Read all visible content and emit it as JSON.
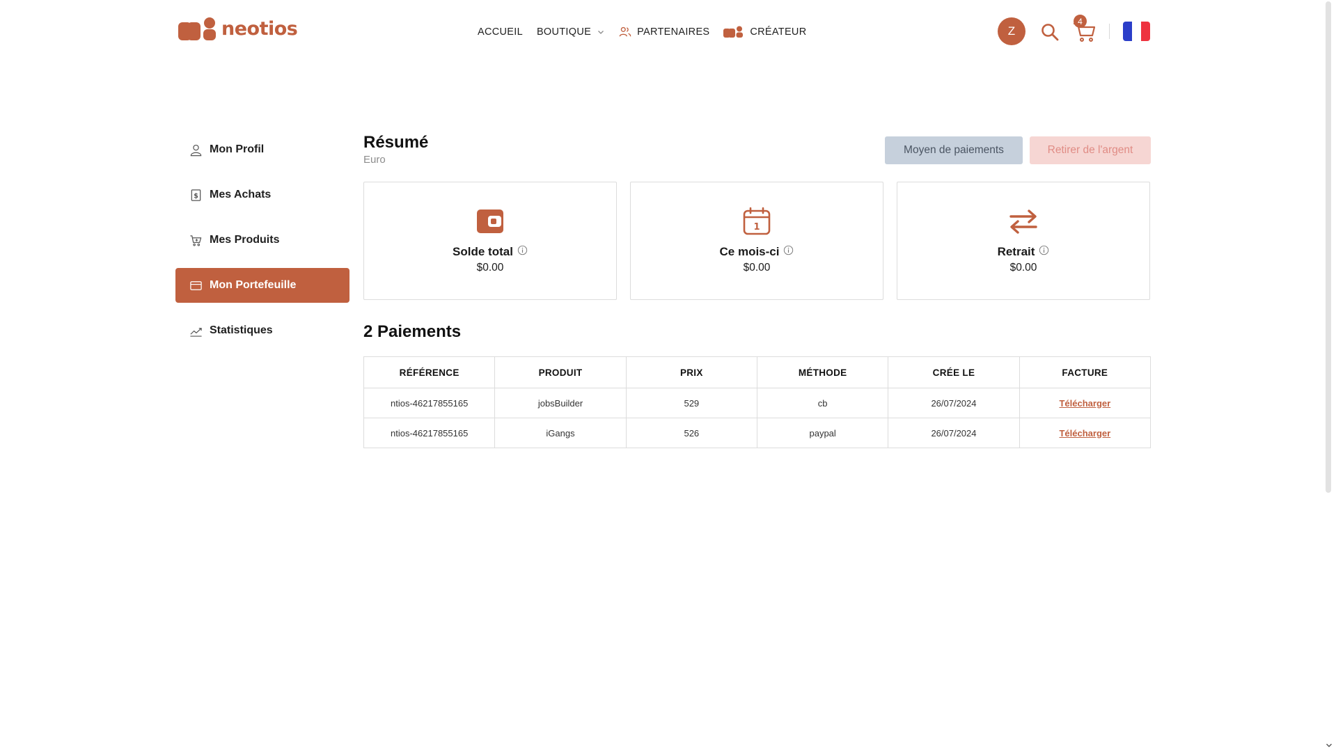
{
  "brand": {
    "name": "neotios",
    "color": "#c0603f"
  },
  "nav": {
    "items": [
      {
        "label": "ACCUEIL"
      },
      {
        "label": "BOUTIQUE",
        "icon": "chevron-down-icon"
      },
      {
        "label": "PARTENAIRES",
        "icon": "partners-icon"
      },
      {
        "label": "CRÉATEUR",
        "icon": "creator-icon"
      }
    ]
  },
  "header": {
    "avatar_initial": "Z",
    "cart_count": "4",
    "language_flag": "france-flag-icon"
  },
  "sidebar": {
    "items": [
      {
        "label": "Mon Profil",
        "icon": "user-icon",
        "active": false
      },
      {
        "label": "Mes Achats",
        "icon": "receipt-icon",
        "active": false
      },
      {
        "label": "Mes Produits",
        "icon": "cart-plus-icon",
        "active": false
      },
      {
        "label": "Mon Portefeuille",
        "icon": "wallet-icon",
        "active": true
      },
      {
        "label": "Statistiques",
        "icon": "chart-line-icon",
        "active": false
      }
    ]
  },
  "main": {
    "title": "Résumé",
    "subtitle": "Euro",
    "buttons": {
      "payment_methods": "Moyen de paiements",
      "withdraw": "Retirer de l'argent"
    },
    "cards": [
      {
        "label": "Solde total",
        "value": "$0.00",
        "icon": "wallet-icon"
      },
      {
        "label": "Ce mois-ci",
        "value": "$0.00",
        "icon": "calendar-icon"
      },
      {
        "label": "Retrait",
        "value": "$0.00",
        "icon": "transfer-icon"
      }
    ],
    "payments_title": "2 Paiements",
    "table": {
      "headers": [
        "RÉFÉRENCE",
        "PRODUIT",
        "PRIX",
        "MÉTHODE",
        "CRÉE LE",
        "FACTURE"
      ],
      "rows": [
        {
          "reference": "ntios-46217855165",
          "product": "jobsBuilder",
          "price": "529",
          "method": "cb",
          "created": "26/07/2024",
          "invoice": "Télécharger"
        },
        {
          "reference": "ntios-46217855165",
          "product": "iGangs",
          "price": "526",
          "method": "paypal",
          "created": "26/07/2024",
          "invoice": "Télécharger"
        }
      ]
    }
  }
}
